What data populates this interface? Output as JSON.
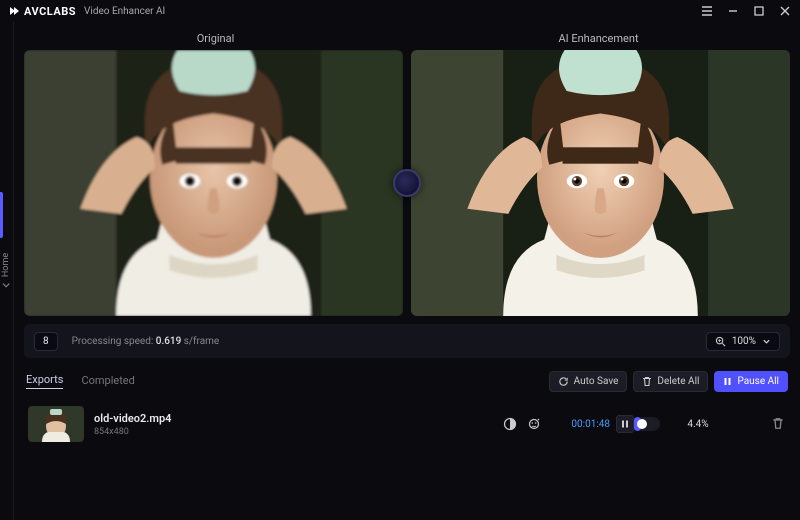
{
  "app": {
    "brand": "AVCLABS",
    "subtitle": "Video Enhancer AI"
  },
  "side": {
    "home_label": "Home"
  },
  "compare": {
    "left_label": "Original",
    "right_label": "AI Enhancement"
  },
  "status": {
    "frame": "8",
    "speed_prefix": "Processing speed:",
    "speed_value": "0.619",
    "speed_unit": "s/frame",
    "zoom": "100%"
  },
  "tabs": {
    "exports": "Exports",
    "completed": "Completed"
  },
  "actions": {
    "autosave": "Auto Save",
    "delete_all": "Delete All",
    "pause_all": "Pause All"
  },
  "export_item": {
    "file_name": "old-video2.mp4",
    "resolution": "854x480",
    "elapsed": "00:01:48",
    "progress_pct": "4.4%",
    "progress_value": 4.4
  },
  "icons": {
    "menu": "menu-icon",
    "minimize": "minimize-icon",
    "maximize": "maximize-icon",
    "close": "close-icon",
    "magnify": "magnify-icon",
    "chevron_down": "chevron-down-icon",
    "refresh": "refresh-icon",
    "trash": "trash-icon",
    "pause": "pause-icon",
    "contrast": "contrast-icon",
    "face": "face-icon",
    "chevron_left": "chevron-left-icon"
  }
}
